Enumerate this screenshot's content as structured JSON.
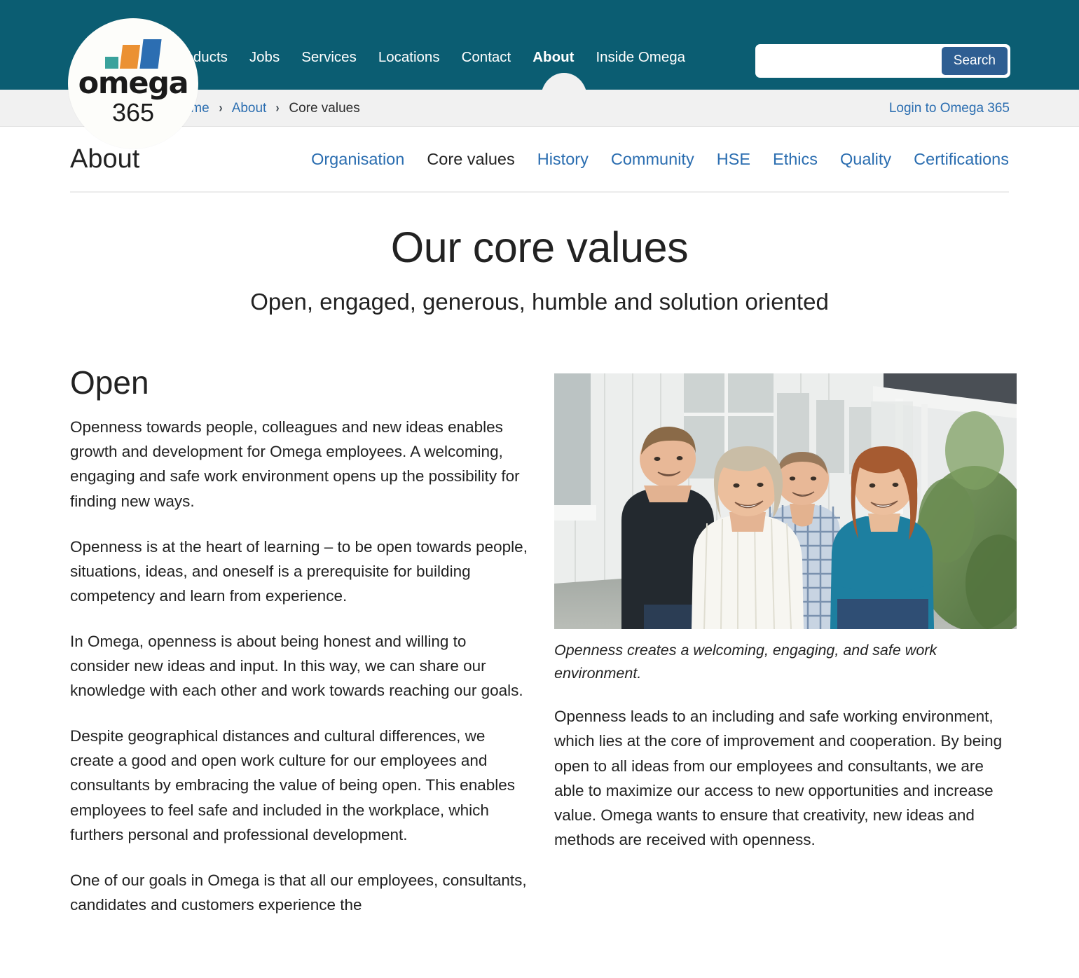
{
  "header": {
    "nav_items": [
      {
        "label": "Products",
        "active": false
      },
      {
        "label": "Jobs",
        "active": false
      },
      {
        "label": "Services",
        "active": false
      },
      {
        "label": "Locations",
        "active": false
      },
      {
        "label": "Contact",
        "active": false
      },
      {
        "label": "About",
        "active": true
      },
      {
        "label": "Inside Omega",
        "active": false
      }
    ],
    "search": {
      "value": "",
      "placeholder": "",
      "button_label": "Search"
    },
    "logo": {
      "word": "omega",
      "sub": "365",
      "bar_colors": [
        "#3aa29c",
        "#eb9133",
        "#2c6eb2"
      ]
    },
    "bar_color": "#0b5d72"
  },
  "breadcrumb": {
    "items": [
      {
        "label": "Home",
        "link": true
      },
      {
        "label": "About",
        "link": true
      },
      {
        "label": "Core values",
        "link": false
      }
    ],
    "separator": "›",
    "login_label": "Login to Omega 365"
  },
  "subnav": {
    "section_title": "About",
    "items": [
      {
        "label": "Organisation",
        "active": false
      },
      {
        "label": "Core values",
        "active": true
      },
      {
        "label": "History",
        "active": false
      },
      {
        "label": "Community",
        "active": false
      },
      {
        "label": "HSE",
        "active": false
      },
      {
        "label": "Ethics",
        "active": false
      },
      {
        "label": "Quality",
        "active": false
      },
      {
        "label": "Certifications",
        "active": false
      }
    ]
  },
  "hero": {
    "title": "Our core values",
    "subtitle": "Open, engaged, generous, humble and solution oriented"
  },
  "main": {
    "left": {
      "heading": "Open",
      "paragraphs": [
        "Openness towards people, colleagues and new ideas enables growth and development for Omega employees. A welcoming, engaging and safe work environment opens up the possibility for finding new ways.",
        "Openness is at the heart of learning – to be open towards people, situations, ideas, and oneself is a prerequisite for building competency and learn from experience.",
        "In Omega, openness is about being honest and willing to consider new ideas and input. In this way, we can share our knowledge with each other and work towards reaching our goals.",
        "Despite geographical distances and cultural differences, we create a good and open work culture for our employees and consultants by embracing the value of being open. This enables employees to feel safe and included in the workplace, which furthers personal and professional development.",
        "One of our goals in Omega is that all our employees, consultants, candidates and customers experience the"
      ]
    },
    "right": {
      "image_alt": "Four smiling Omega colleagues standing outside a white wooden office building",
      "caption": "Openness creates a welcoming, engaging, and safe work environment.",
      "paragraphs": [
        "Openness leads to an including and safe working environment, which lies at the core of improvement and cooperation. By being open to all ideas from our employees and consultants, we are able to maximize our access to new opportunities and increase value. Omega wants to ensure that creativity, new ideas and methods are received with openness."
      ]
    }
  },
  "colors": {
    "brand_teal": "#0b5d72",
    "link_blue": "#2a6db0",
    "button_blue": "#2e5e92",
    "text_dark": "#222222",
    "crumb_bg": "#f1f1f1"
  }
}
